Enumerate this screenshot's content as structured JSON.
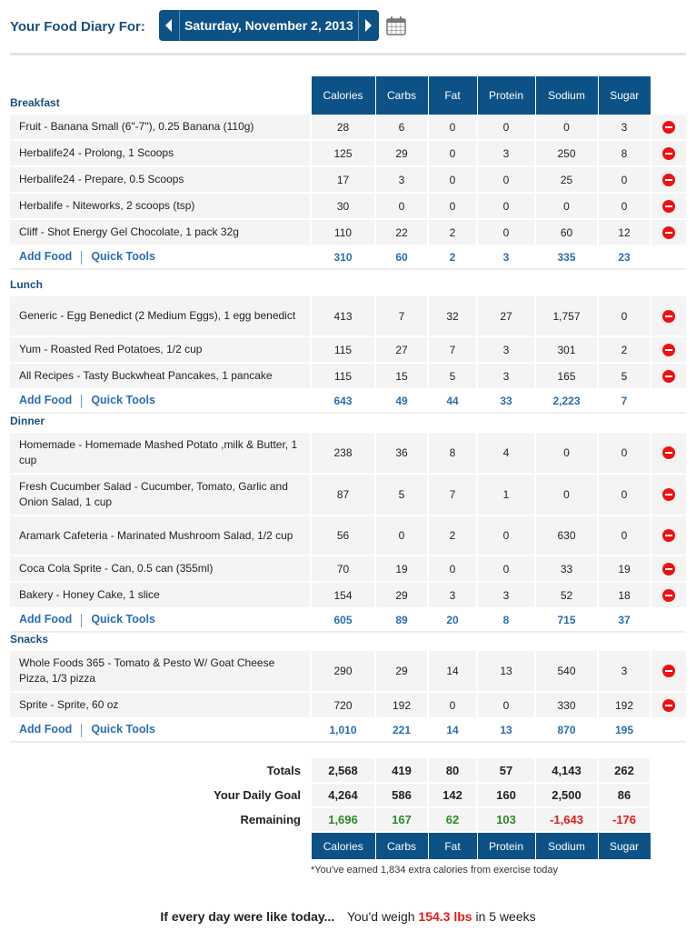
{
  "header": {
    "label": "Your Food Diary For:",
    "date": "Saturday, November 2, 2013",
    "prev_icon": "chevron-left-icon",
    "next_icon": "chevron-right-icon",
    "calendar_icon": "calendar-icon"
  },
  "columns": [
    "Calories",
    "Carbs",
    "Fat",
    "Protein",
    "Sodium",
    "Sugar"
  ],
  "links": {
    "add_food": "Add Food",
    "quick_tools": "Quick Tools"
  },
  "meals": [
    {
      "title": "Breakfast",
      "items": [
        {
          "name": "Fruit - Banana Small (6\"-7\"), 0.25 Banana (110g)",
          "values": [
            "28",
            "6",
            "0",
            "0",
            "0",
            "3"
          ]
        },
        {
          "name": "Herbalife24 - Prolong, 1 Scoops",
          "values": [
            "125",
            "29",
            "0",
            "3",
            "250",
            "8"
          ]
        },
        {
          "name": "Herbalife24 - Prepare, 0.5 Scoops",
          "values": [
            "17",
            "3",
            "0",
            "0",
            "25",
            "0"
          ]
        },
        {
          "name": "Herbalife - Niteworks, 2 scoops (tsp)",
          "values": [
            "30",
            "0",
            "0",
            "0",
            "0",
            "0"
          ]
        },
        {
          "name": "Cliff - Shot Energy Gel Chocolate, 1 pack 32g",
          "values": [
            "110",
            "22",
            "2",
            "0",
            "60",
            "12"
          ]
        }
      ],
      "totals": [
        "310",
        "60",
        "2",
        "3",
        "335",
        "23"
      ]
    },
    {
      "title": "Lunch",
      "items": [
        {
          "name": "Generic - Egg Benedict (2 Medium Eggs), 1 egg benedict",
          "values": [
            "413",
            "7",
            "32",
            "27",
            "1,757",
            "0"
          ]
        },
        {
          "name": "Yum - Roasted Red Potatoes, 1/2 cup",
          "values": [
            "115",
            "27",
            "7",
            "3",
            "301",
            "2"
          ]
        },
        {
          "name": "All Recipes - Tasty Buckwheat Pancakes, 1 pancake",
          "values": [
            "115",
            "15",
            "5",
            "3",
            "165",
            "5"
          ]
        }
      ],
      "totals": [
        "643",
        "49",
        "44",
        "33",
        "2,223",
        "7"
      ]
    },
    {
      "title": "Dinner",
      "items": [
        {
          "name": "Homemade - Homemade Mashed Potato ,milk & Butter, 1 cup",
          "values": [
            "238",
            "36",
            "8",
            "4",
            "0",
            "0"
          ]
        },
        {
          "name": "Fresh Cucumber Salad - Cucumber, Tomato, Garlic and Onion Salad, 1 cup",
          "values": [
            "87",
            "5",
            "7",
            "1",
            "0",
            "0"
          ]
        },
        {
          "name": "Aramark Cafeteria - Marinated Mushroom Salad, 1/2 cup",
          "values": [
            "56",
            "0",
            "2",
            "0",
            "630",
            "0"
          ]
        },
        {
          "name": "Coca Cola Sprite - Can, 0.5 can (355ml)",
          "values": [
            "70",
            "19",
            "0",
            "0",
            "33",
            "19"
          ]
        },
        {
          "name": "Bakery - Honey Cake, 1 slice",
          "values": [
            "154",
            "29",
            "3",
            "3",
            "52",
            "18"
          ]
        }
      ],
      "totals": [
        "605",
        "89",
        "20",
        "8",
        "715",
        "37"
      ]
    },
    {
      "title": "Snacks",
      "items": [
        {
          "name": "Whole Foods 365 - Tomato & Pesto W/ Goat Cheese Pizza, 1/3 pizza",
          "values": [
            "290",
            "29",
            "14",
            "13",
            "540",
            "3"
          ]
        },
        {
          "name": "Sprite - Sprite, 60 oz",
          "values": [
            "720",
            "192",
            "0",
            "0",
            "330",
            "192"
          ]
        }
      ],
      "totals": [
        "1,010",
        "221",
        "14",
        "13",
        "870",
        "195"
      ]
    }
  ],
  "summary": {
    "totals_label": "Totals",
    "totals": [
      "2,568",
      "419",
      "80",
      "57",
      "4,143",
      "262"
    ],
    "goal_label": "Your Daily Goal",
    "goal": [
      "4,264",
      "586",
      "142",
      "160",
      "2,500",
      "86"
    ],
    "remaining_label": "Remaining",
    "remaining": [
      "1,696",
      "167",
      "62",
      "103",
      "-1,643",
      "-176"
    ],
    "exercise_note": "*You've earned 1,834 extra calories from exercise today"
  },
  "projection": {
    "lead": "If every day were like today...",
    "prefix": "You'd weigh",
    "weight": "154.3 lbs",
    "suffix": "in 5 weeks"
  },
  "colors": {
    "brand_blue": "#0d5286",
    "heading_blue": "#1b4f7a",
    "link_blue": "#2a6eb0",
    "positive_green": "#2e8b25",
    "negative_red": "#e41b17"
  }
}
